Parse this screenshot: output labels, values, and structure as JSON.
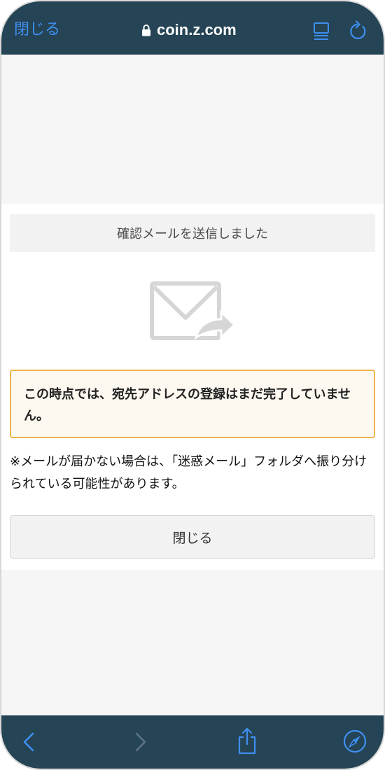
{
  "browser": {
    "close_label": "閉じる",
    "url": "coin.z.com",
    "icons": {
      "lock": "lock-icon",
      "reader": "reader-mode-icon",
      "reload": "reload-icon",
      "back": "back-icon",
      "forward": "forward-icon",
      "share": "share-icon",
      "compass": "safari-compass-icon"
    },
    "colors": {
      "bar": "#254455",
      "accent": "#3f8ff0"
    }
  },
  "page": {
    "header": "確認メールを送信しました",
    "mail_icon": "mail-sent-icon",
    "notice": "この時点では、宛先アドレスの登録はまだ完了していません。",
    "note": "※メールが届かない場合は、「迷惑メール」フォルダへ振り分けられている可能性があります。",
    "close_button": "閉じる",
    "colors": {
      "notice_border": "#f0b44c",
      "notice_bg": "#fdf8f0"
    }
  }
}
